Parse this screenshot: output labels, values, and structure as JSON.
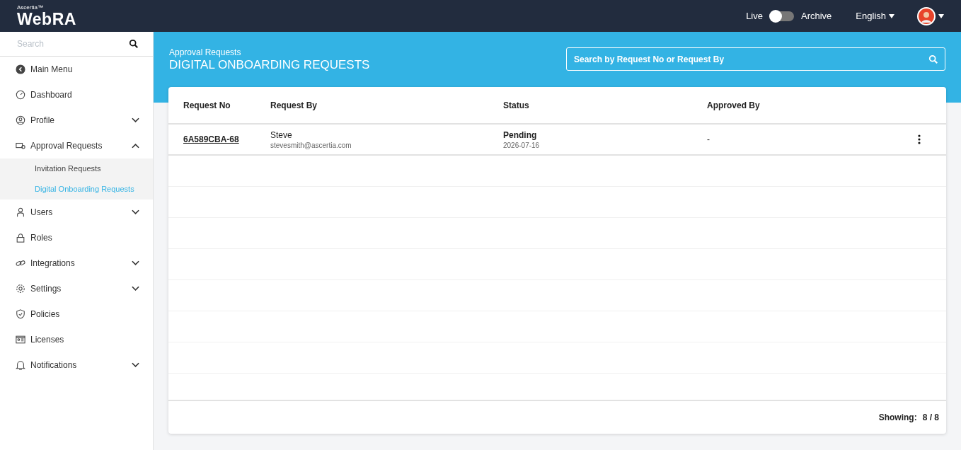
{
  "header": {
    "logo_small": "Ascertia™",
    "logo": "WebRA",
    "toggle": {
      "left_label": "Live",
      "right_label": "Archive",
      "on": false
    },
    "language": "English"
  },
  "sidebar": {
    "search": {
      "placeholder": "Search"
    },
    "items": [
      {
        "label": "Main Menu"
      },
      {
        "label": "Dashboard"
      },
      {
        "label": "Profile",
        "expanded": false
      },
      {
        "label": "Approval Requests",
        "expanded": true,
        "children": [
          {
            "label": "Invitation Requests",
            "selected": false
          },
          {
            "label": "Digital Onboarding Requests",
            "selected": true
          }
        ]
      },
      {
        "label": "Users",
        "expanded": false
      },
      {
        "label": "Roles"
      },
      {
        "label": "Integrations",
        "expanded": false
      },
      {
        "label": "Settings",
        "expanded": false
      },
      {
        "label": "Policies"
      },
      {
        "label": "Licenses"
      },
      {
        "label": "Notifications",
        "expanded": false
      }
    ]
  },
  "page": {
    "breadcrumb": "Approval Requests",
    "title": "DIGITAL ONBOARDING REQUESTS",
    "search": {
      "placeholder": "Search by Request No or Request By"
    }
  },
  "table": {
    "columns": [
      "Request No",
      "Request By",
      "Status",
      "Approved By"
    ],
    "rows": [
      {
        "request_no": "6A589CBA-68",
        "name": "Steve",
        "email": "stevesmith@ascertia.com",
        "status": "Pending",
        "date": "2026-07-16",
        "approved_by": "-"
      }
    ]
  },
  "footer": {
    "label": "Showing:",
    "count": "8 / 8"
  }
}
